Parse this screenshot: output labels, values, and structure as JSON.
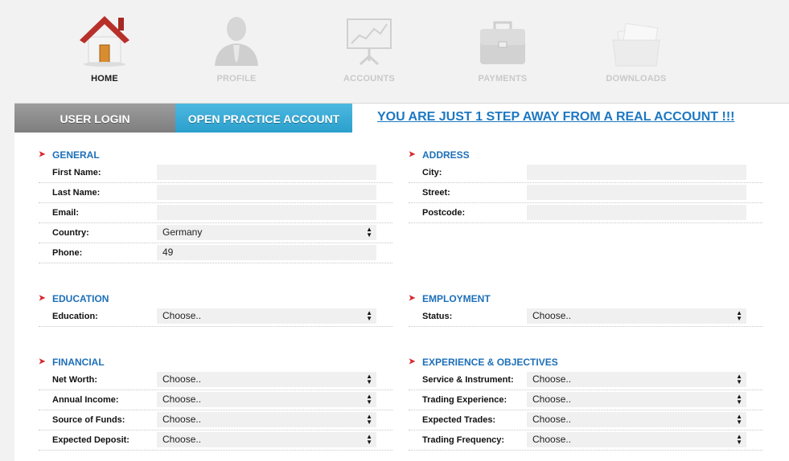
{
  "nav": {
    "items": [
      {
        "label": "HOME",
        "icon": "home-icon",
        "active": true
      },
      {
        "label": "PROFILE",
        "icon": "profile-icon",
        "active": false
      },
      {
        "label": "ACCOUNTS",
        "icon": "accounts-icon",
        "active": false
      },
      {
        "label": "PAYMENTS",
        "icon": "briefcase-icon",
        "active": false
      },
      {
        "label": "DOWNLOADS",
        "icon": "downloads-icon",
        "active": false
      }
    ]
  },
  "tabs": {
    "user_login": "USER LOGIN",
    "open_practice": "OPEN PRACTICE ACCOUNT"
  },
  "step_link": "YOU ARE JUST 1 STEP AWAY FROM A REAL ACCOUNT !!!",
  "sections": {
    "general": {
      "title": "GENERAL",
      "fields": [
        {
          "label": "First Name:",
          "value": ""
        },
        {
          "label": "Last Name:",
          "value": ""
        },
        {
          "label": "Email:",
          "value": ""
        },
        {
          "label": "Country:",
          "value": "Germany"
        },
        {
          "label": "Phone:",
          "value": "49"
        }
      ]
    },
    "address": {
      "title": "ADDRESS",
      "fields": [
        {
          "label": "City:",
          "value": ""
        },
        {
          "label": "Street:",
          "value": ""
        },
        {
          "label": "Postcode:",
          "value": ""
        }
      ]
    },
    "education": {
      "title": "EDUCATION",
      "fields": [
        {
          "label": "Education:",
          "value": "Choose.."
        }
      ]
    },
    "employment": {
      "title": "EMPLOYMENT",
      "fields": [
        {
          "label": "Status:",
          "value": "Choose.."
        }
      ]
    },
    "financial": {
      "title": "FINANCIAL",
      "fields": [
        {
          "label": "Net Worth:",
          "value": "Choose.."
        },
        {
          "label": "Annual Income:",
          "value": "Choose.."
        },
        {
          "label": "Source of Funds:",
          "value": "Choose.."
        },
        {
          "label": "Expected Deposit:",
          "value": "Choose.."
        }
      ]
    },
    "experience": {
      "title": "EXPERIENCE & OBJECTIVES",
      "fields": [
        {
          "label": "Service & Instrument:",
          "value": "Choose.."
        },
        {
          "label": "Trading Experience:",
          "value": "Choose.."
        },
        {
          "label": "Expected Trades:",
          "value": "Choose.."
        },
        {
          "label": "Trading Frequency:",
          "value": "Choose.."
        }
      ]
    }
  },
  "colors": {
    "section_title": "#1d6fb8",
    "link": "#1d78c2",
    "arrow": "#d8262c",
    "practice_tab": "#2b9fcc",
    "login_tab": "#8a8a8a"
  }
}
